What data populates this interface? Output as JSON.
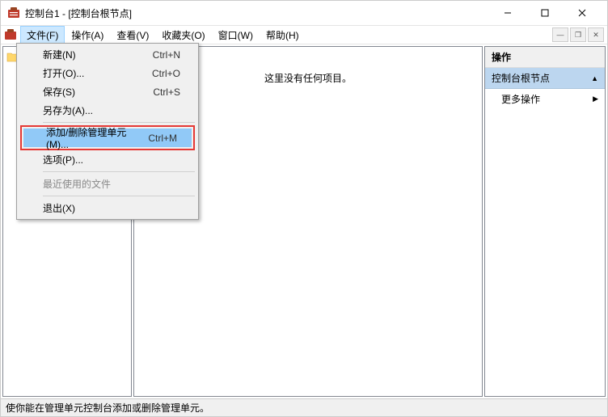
{
  "window": {
    "title": "控制台1 - [控制台根节点]"
  },
  "menubar": {
    "file": "文件(F)",
    "operate": "操作(A)",
    "view": "查看(V)",
    "favorites": "收藏夹(O)",
    "window": "窗口(W)",
    "help": "帮助(H)"
  },
  "filemenu": {
    "new": {
      "label": "新建(N)",
      "shortcut": "Ctrl+N"
    },
    "open": {
      "label": "打开(O)...",
      "shortcut": "Ctrl+O"
    },
    "save": {
      "label": "保存(S)",
      "shortcut": "Ctrl+S"
    },
    "saveas": {
      "label": "另存为(A)..."
    },
    "addremove": {
      "label": "添加/删除管理单元(M)...",
      "shortcut": "Ctrl+M"
    },
    "options": {
      "label": "选项(P)..."
    },
    "recent": {
      "label": "最近使用的文件"
    },
    "exit": {
      "label": "退出(X)"
    }
  },
  "center": {
    "empty": "这里没有任何项目。"
  },
  "right": {
    "header": "操作",
    "section": "控制台根节点",
    "more": "更多操作"
  },
  "status": "使你能在管理单元控制台添加或删除管理单元。"
}
